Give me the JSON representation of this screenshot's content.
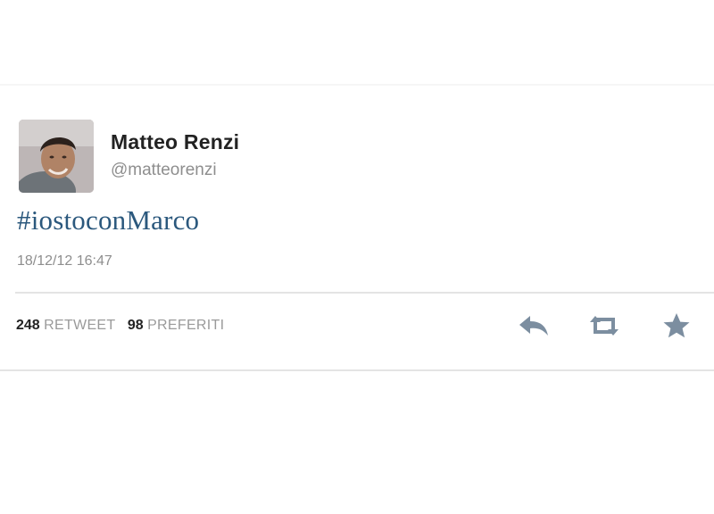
{
  "tweet": {
    "author_name": "Matteo Renzi",
    "author_handle": "@matteorenzi",
    "text": "#iostoconMarco",
    "timestamp": "18/12/12 16:47",
    "retweet_count": "248",
    "retweet_label": "RETWEET",
    "favorite_count": "98",
    "favorite_label": "PREFERITI"
  },
  "actions": {
    "icons": [
      "reply-icon",
      "retweet-icon",
      "favorite-star-icon"
    ]
  },
  "colors": {
    "link_blue": "#2b587d",
    "icon_gray": "#7c8ea0",
    "text_dark": "#222222",
    "text_gray": "#8e8e8e"
  }
}
